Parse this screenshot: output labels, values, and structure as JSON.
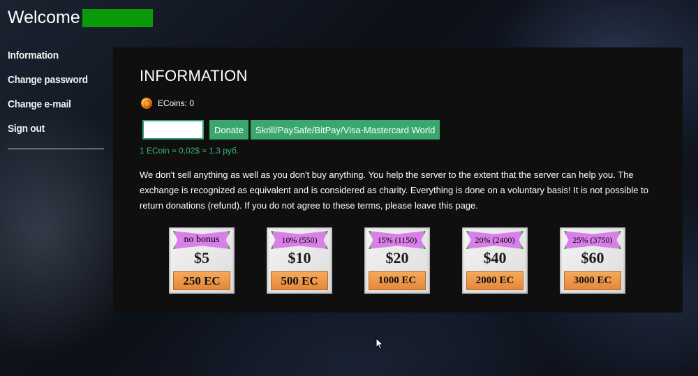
{
  "header": {
    "welcome": "Welcome"
  },
  "nav": {
    "items": [
      "Information",
      "Change password",
      "Change e-mail",
      "Sign out"
    ]
  },
  "panel": {
    "title": "INFORMATION",
    "coins_label": "ECoins: 0",
    "amount_value": "",
    "donate_label": "Donate",
    "methods_label": "Skrill/PaySafe/BitPay/Visa-Mastercard World",
    "rate": "1 ECoin ≈ 0,02$ ≈ 1.3 руб.",
    "disclaimer": "We don't sell anything as well as you don't buy anything. You help the server to the extent that the server can help you. The exchange is recognized as equivalent and is considered as charity. Everything is done on a voluntary basis! It is not possible to return donations (refund). If you do not agree to these terms, please leave this page."
  },
  "packs": [
    {
      "bonus": "no bonus",
      "price": "$5",
      "ec": "250 EC"
    },
    {
      "bonus": "10% (550)",
      "price": "$10",
      "ec": "500 EC"
    },
    {
      "bonus": "15% (1150)",
      "price": "$20",
      "ec": "1000 EC"
    },
    {
      "bonus": "20% (2400)",
      "price": "$40",
      "ec": "2000 EC"
    },
    {
      "bonus": "25% (3750)",
      "price": "$60",
      "ec": "3000 EC"
    }
  ],
  "colors": {
    "accent": "#3aa86e",
    "rate_text": "#3cb371",
    "redacted_name": "#0a9a0a",
    "banner": "#d880e8",
    "ec_badge": "#f0a050"
  },
  "icons": [
    "coin-icon",
    "mouse-cursor-icon"
  ]
}
